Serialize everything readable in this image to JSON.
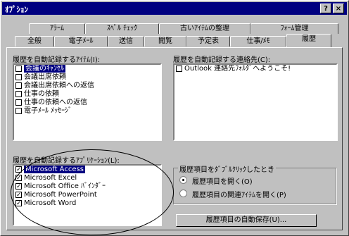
{
  "window": {
    "title": "ｵﾌﾟｼｮﾝ",
    "help_label": "?",
    "close_label": "×"
  },
  "tabs_back": [
    {
      "name": "tab-alarm",
      "label": "ｱﾗｰﾑ"
    },
    {
      "name": "tab-spell-check",
      "label": "ｽﾍﾟﾙ ﾁｪｯｸ"
    },
    {
      "name": "tab-old-items",
      "label": "古いｱｲﾃﾑの整理"
    },
    {
      "name": "tab-form-manage",
      "label": "ﾌｫｰﾑ管理"
    }
  ],
  "tabs_front": [
    {
      "name": "tab-general",
      "label": "全般"
    },
    {
      "name": "tab-email",
      "label": "電子ﾒｰﾙ"
    },
    {
      "name": "tab-send",
      "label": "送信"
    },
    {
      "name": "tab-read",
      "label": "閲覧"
    },
    {
      "name": "tab-calendar",
      "label": "予定表"
    },
    {
      "name": "tab-tasks",
      "label": "仕事/ﾒﾓ"
    },
    {
      "name": "tab-journal",
      "label": "履歴"
    }
  ],
  "items_section": {
    "label": "履歴を自動記録するｱｲﾃﾑ(I):",
    "items": [
      {
        "label": "会議のｷｬﾝｾﾙ",
        "checked": false,
        "selected": true
      },
      {
        "label": "会議出席依頼",
        "checked": false,
        "selected": false
      },
      {
        "label": "会議出席依頼への返信",
        "checked": false,
        "selected": false
      },
      {
        "label": "仕事の依頼",
        "checked": false,
        "selected": false
      },
      {
        "label": "仕事の依頼への返信",
        "checked": false,
        "selected": false
      },
      {
        "label": "電子ﾒｰﾙ ﾒｯｾｰｼﾞ",
        "checked": false,
        "selected": false
      }
    ]
  },
  "contacts_section": {
    "label": "履歴を自動記録する連絡先(C):",
    "items": [
      {
        "label": "Outlook 連絡先ﾌｫﾙﾀﾞへようこそ!",
        "checked": false
      }
    ]
  },
  "apps_section": {
    "label": "履歴を自動記録するｱﾌﾟﾘｹｰｼｮﾝ(L):",
    "items": [
      {
        "label": "Microsoft Access",
        "checked": true,
        "selected": true
      },
      {
        "label": "Microsoft Excel",
        "checked": true,
        "selected": false
      },
      {
        "label": "Microsoft Office ﾊﾞｲﾝﾀﾞｰ",
        "checked": true,
        "selected": false
      },
      {
        "label": "Microsoft PowerPoint",
        "checked": true,
        "selected": false
      },
      {
        "label": "Microsoft Word",
        "checked": true,
        "selected": false
      }
    ]
  },
  "dblclick_group": {
    "title": "履歴項目をﾀﾞﾌﾞﾙｸﾘｯｸしたとき",
    "option_open_entry": "履歴項目を開く(O)",
    "option_open_item": "履歴項目の関連ｱｲﾃﾑを開く(P)",
    "selected": "open_entry"
  },
  "autoarchive_button": "履歴項目の自動保存(U)..."
}
